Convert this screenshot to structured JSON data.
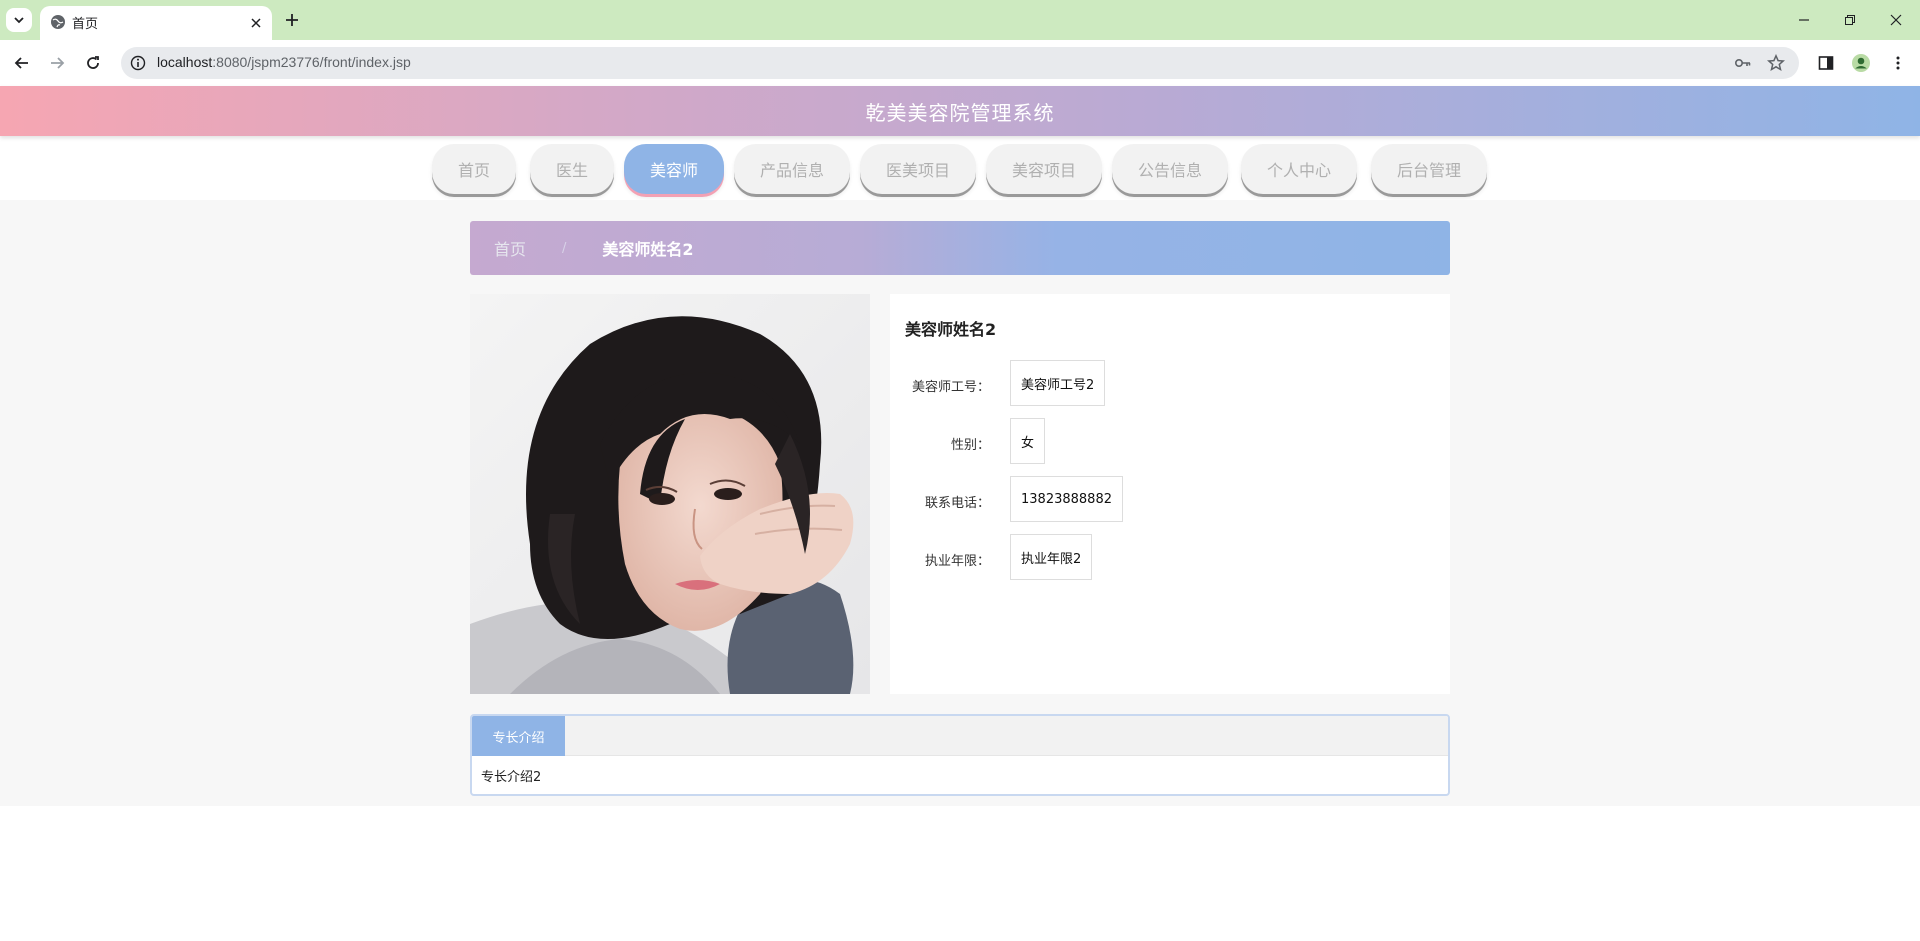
{
  "browser": {
    "tab_title": "首页",
    "url_host": "localhost",
    "url_rest": ":8080/jspm23776/front/index.jsp"
  },
  "site": {
    "title": "乾美美容院管理系统"
  },
  "nav": {
    "items": [
      "首页",
      "医生",
      "美容师",
      "产品信息",
      "医美项目",
      "美容项目",
      "公告信息",
      "个人中心",
      "后台管理"
    ],
    "active_index": 2
  },
  "breadcrumb": {
    "home": "首页",
    "separator": "/",
    "current": "美容师姓名2"
  },
  "detail": {
    "name": "美容师姓名2",
    "fields": [
      {
        "label": "美容师工号：",
        "value": "美容师工号2"
      },
      {
        "label": "性别：",
        "value": "女"
      },
      {
        "label": "联系电话：",
        "value": "13823888882"
      },
      {
        "label": "执业年限：",
        "value": "执业年限2"
      }
    ]
  },
  "tabs": {
    "active_label": "专长介绍",
    "content": "专长介绍2"
  },
  "colors": {
    "accent_blue": "#8fb4e6",
    "accent_pink": "#f6a6b2",
    "chrome_green": "#cdeac0"
  }
}
